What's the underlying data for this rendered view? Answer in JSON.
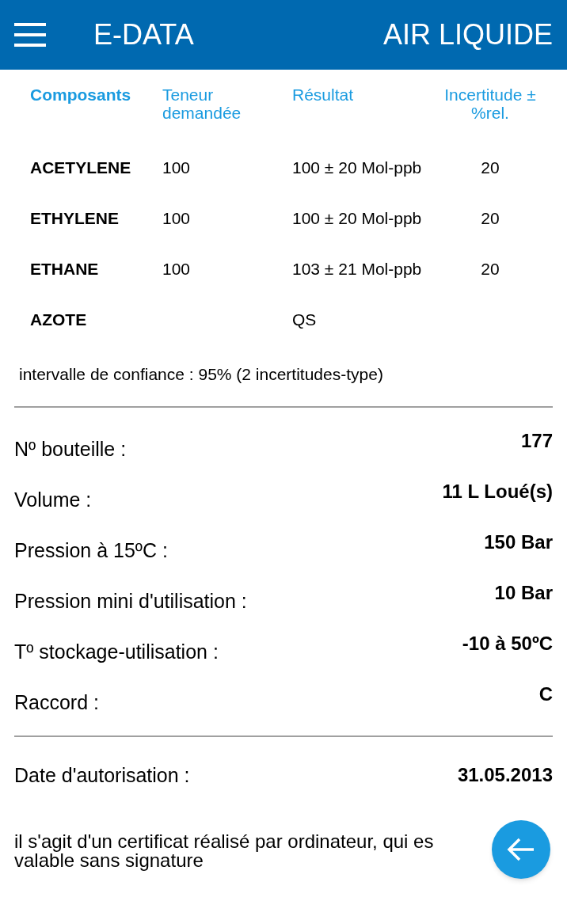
{
  "app_bar": {
    "title": "E-DATA",
    "brand": "AIR LIQUIDE"
  },
  "table": {
    "columns": [
      "Composants",
      "Teneur demandée",
      "Résultat",
      "Incertitude ± %rel."
    ],
    "rows": [
      {
        "component": "ACETYLENE",
        "requested": "100",
        "result": "100 ± 20 Mol-ppb",
        "uncertainty": "20"
      },
      {
        "component": "ETHYLENE",
        "requested": "100",
        "result": "100 ± 20 Mol-ppb",
        "uncertainty": "20"
      },
      {
        "component": "ETHANE",
        "requested": "100",
        "result": "103 ± 21 Mol-ppb",
        "uncertainty": "20"
      },
      {
        "component": "AZOTE",
        "result": "QS"
      }
    ]
  },
  "confidence_note": "intervalle de confiance : 95% (2 incertitudes-type)",
  "details": [
    {
      "label": "Nº bouteille :",
      "value": "177"
    },
    {
      "label": "Volume :",
      "value": "11 L Loué(s)"
    },
    {
      "label": "Pression à 15ºC :",
      "value": "150 Bar"
    },
    {
      "label": "Pression mini d'utilisation :",
      "value": "10 Bar"
    },
    {
      "label": "Tº stockage-utilisation :",
      "value": "-10 à 50ºC"
    },
    {
      "label": "Raccord :",
      "value": "C"
    }
  ],
  "authorization": {
    "label": "Date d'autorisation :",
    "value": "31.05.2013"
  },
  "footer_note": [
    "il s'agit d'un certificat réalisé par ordinateur, qui es",
    "valable sans signature"
  ]
}
